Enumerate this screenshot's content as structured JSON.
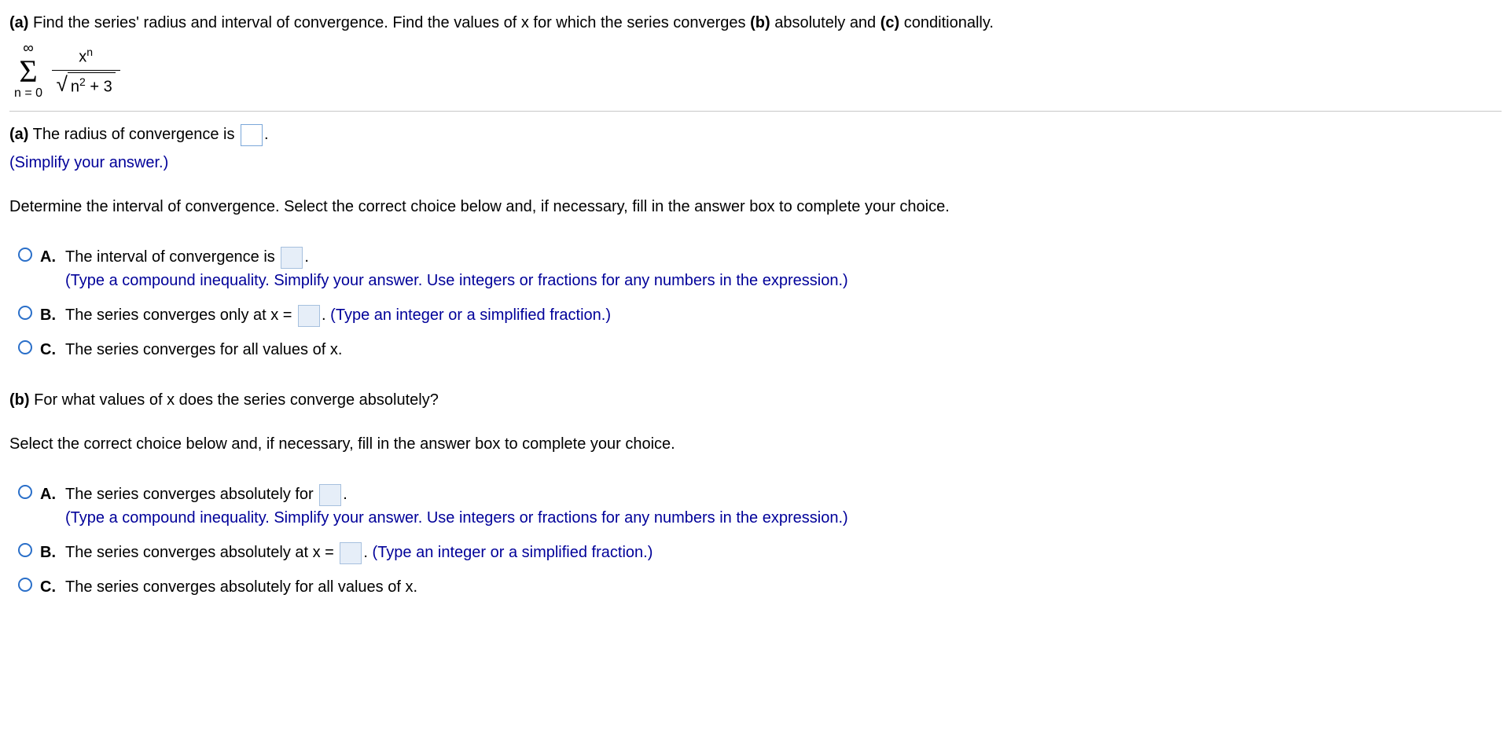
{
  "questionIntro": {
    "part_a_label": "(a)",
    "intro_text_1": " Find the series' radius and interval of convergence. Find the values of x for which the series converges ",
    "part_b_label": "(b)",
    "intro_text_2": " absolutely and ",
    "part_c_label": "(c)",
    "intro_text_3": " conditionally."
  },
  "formula": {
    "sigma_top": "∞",
    "sigma_bottom": "n = 0",
    "numerator_base": "x",
    "numerator_exp": "n",
    "denominator_inside_base": "n",
    "denominator_inside_exp": "2",
    "denominator_plus": " + 3"
  },
  "partA": {
    "label": "(a)",
    "radius_text_before": " The radius of convergence is ",
    "radius_text_after": ".",
    "simplify_hint": "(Simplify your answer.)",
    "interval_prompt": "Determine the interval of convergence. Select the correct choice below and, if necessary, fill in the answer box to complete your choice.",
    "choices": {
      "A": {
        "letter": "A.",
        "text_before": "The interval of convergence is ",
        "text_after": ".",
        "hint": "(Type a compound inequality. Simplify your answer. Use integers or fractions for any numbers in the expression.)"
      },
      "B": {
        "letter": "B.",
        "text_before": "The series converges only at x = ",
        "text_after": ". ",
        "hint": "(Type an integer or a simplified fraction.)"
      },
      "C": {
        "letter": "C.",
        "text": "The series converges for all values of x."
      }
    }
  },
  "partB": {
    "label": "(b)",
    "prompt": " For what values of x does the series converge absolutely?",
    "select_prompt": "Select the correct choice below and, if necessary, fill in the answer box to complete your choice.",
    "choices": {
      "A": {
        "letter": "A.",
        "text_before": "The series converges absolutely for ",
        "text_after": ".",
        "hint": "(Type a compound inequality. Simplify your answer. Use integers or fractions for any numbers in the expression.)"
      },
      "B": {
        "letter": "B.",
        "text_before": "The series converges absolutely at x = ",
        "text_after": ". ",
        "hint": "(Type an integer or a simplified fraction.)"
      },
      "C": {
        "letter": "C.",
        "text": "The series converges absolutely for all values of x."
      }
    }
  }
}
